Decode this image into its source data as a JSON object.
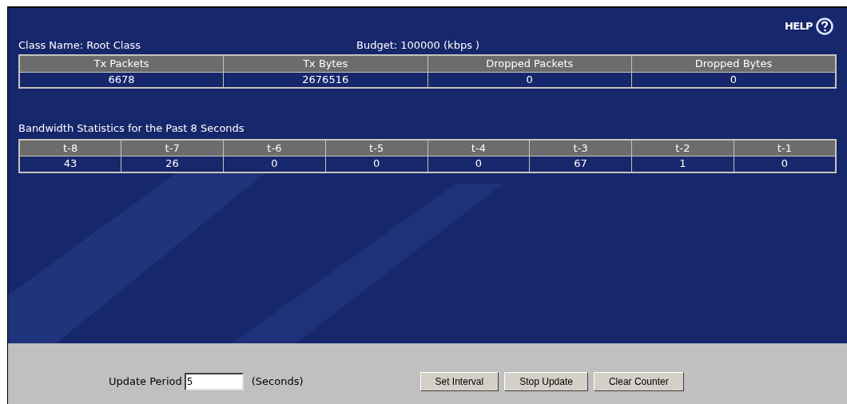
{
  "help": {
    "label": "HELP"
  },
  "class_info": {
    "class_name": "Class Name: Root Class",
    "budget": "Budget: 100000 (kbps )"
  },
  "summary_table": {
    "columns": [
      "Tx Packets",
      "Tx Bytes",
      "Dropped Packets",
      "Dropped Bytes"
    ],
    "rows": [
      [
        "6678",
        "2676516",
        "0",
        "0"
      ]
    ]
  },
  "bandwidth": {
    "title": "Bandwidth Statistics for the Past 8 Seconds",
    "columns": [
      "t-8",
      "t-7",
      "t-6",
      "t-5",
      "t-4",
      "t-3",
      "t-2",
      "t-1"
    ],
    "rows": [
      [
        "43",
        "26",
        "0",
        "0",
        "0",
        "67",
        "1",
        "0"
      ]
    ]
  },
  "update": {
    "label": "Update Period",
    "value": "5",
    "unit": "(Seconds)"
  },
  "buttons": [
    "Set Interval",
    "Stop Update",
    "Clear Counter"
  ]
}
